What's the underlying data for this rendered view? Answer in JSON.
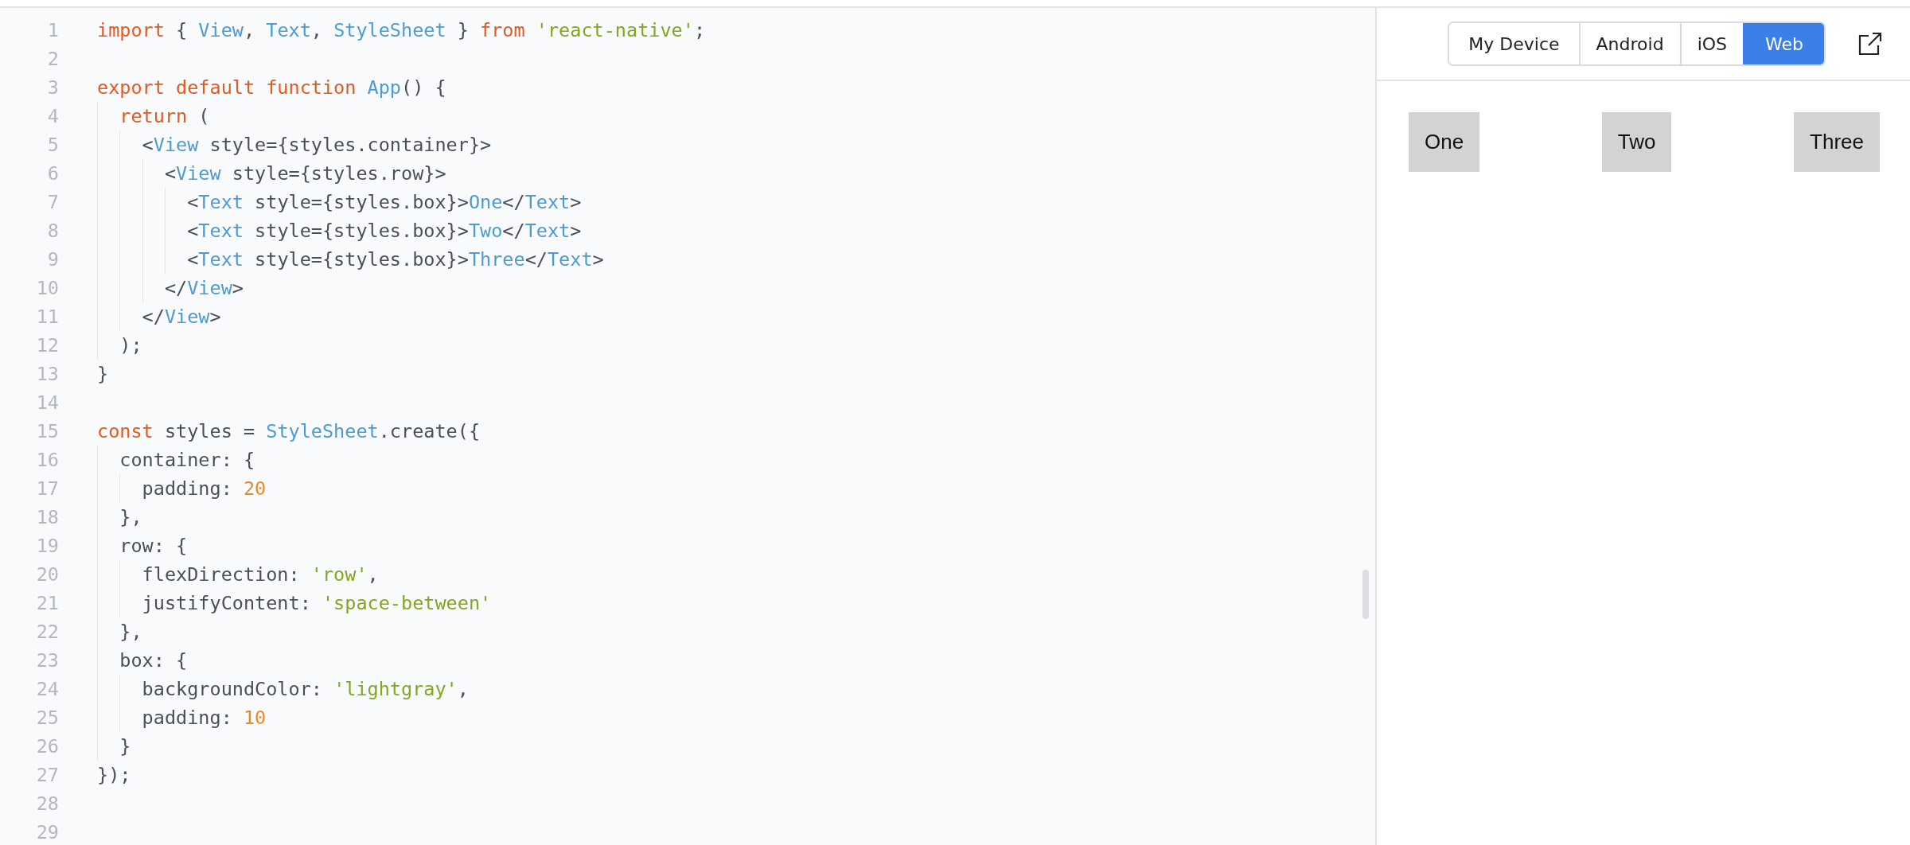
{
  "editor": {
    "lines": [
      {
        "number": "1",
        "tokens": [
          {
            "kind": "keyword",
            "text": "import"
          },
          {
            "kind": "plain",
            "text": " { "
          },
          {
            "kind": "identifier",
            "text": "View"
          },
          {
            "kind": "plain",
            "text": ", "
          },
          {
            "kind": "identifier",
            "text": "Text"
          },
          {
            "kind": "plain",
            "text": ", "
          },
          {
            "kind": "identifier",
            "text": "StyleSheet"
          },
          {
            "kind": "plain",
            "text": " } "
          },
          {
            "kind": "keyword",
            "text": "from "
          },
          {
            "kind": "string",
            "text": "'react-native'"
          },
          {
            "kind": "plain",
            "text": ";"
          }
        ]
      },
      {
        "number": "2"
      },
      {
        "number": "3",
        "tokens": [
          {
            "kind": "keyword",
            "text": "export default function "
          },
          {
            "kind": "identifier",
            "text": "App"
          },
          {
            "kind": "plain",
            "text": "() {"
          }
        ]
      },
      {
        "number": "4",
        "tokens": [
          {
            "kind": "keyword",
            "text": "  return"
          },
          {
            "kind": "plain",
            "text": " ("
          }
        ]
      },
      {
        "number": "5",
        "tokens": [
          {
            "kind": "plain",
            "text": "    <"
          },
          {
            "kind": "identifier",
            "text": "View"
          },
          {
            "kind": "plain",
            "text": " style={styles.container}>"
          }
        ]
      },
      {
        "number": "6",
        "tokens": [
          {
            "kind": "plain",
            "text": "      <"
          },
          {
            "kind": "identifier",
            "text": "View"
          },
          {
            "kind": "plain",
            "text": " style={styles.row}>"
          }
        ]
      },
      {
        "number": "7",
        "tokens": [
          {
            "kind": "plain",
            "text": "        <"
          },
          {
            "kind": "identifier",
            "text": "Text"
          },
          {
            "kind": "plain",
            "text": " style={styles.box}>"
          },
          {
            "kind": "identifier",
            "text": "One"
          },
          {
            "kind": "plain",
            "text": "</"
          },
          {
            "kind": "identifier",
            "text": "Text"
          },
          {
            "kind": "plain",
            "text": ">"
          }
        ]
      },
      {
        "number": "8",
        "tokens": [
          {
            "kind": "plain",
            "text": "        <"
          },
          {
            "kind": "identifier",
            "text": "Text"
          },
          {
            "kind": "plain",
            "text": " style={styles.box}>"
          },
          {
            "kind": "identifier",
            "text": "Two"
          },
          {
            "kind": "plain",
            "text": "</"
          },
          {
            "kind": "identifier",
            "text": "Text"
          },
          {
            "kind": "plain",
            "text": ">"
          }
        ]
      },
      {
        "number": "9",
        "tokens": [
          {
            "kind": "plain",
            "text": "        <"
          },
          {
            "kind": "identifier",
            "text": "Text"
          },
          {
            "kind": "plain",
            "text": " style={styles.box}>"
          },
          {
            "kind": "identifier",
            "text": "Three"
          },
          {
            "kind": "plain",
            "text": "</"
          },
          {
            "kind": "identifier",
            "text": "Text"
          },
          {
            "kind": "plain",
            "text": ">"
          }
        ]
      },
      {
        "number": "10",
        "tokens": [
          {
            "kind": "plain",
            "text": "      </"
          },
          {
            "kind": "identifier",
            "text": "View"
          },
          {
            "kind": "plain",
            "text": ">"
          }
        ]
      },
      {
        "number": "11",
        "tokens": [
          {
            "kind": "plain",
            "text": "    </"
          },
          {
            "kind": "identifier",
            "text": "View"
          },
          {
            "kind": "plain",
            "text": ">"
          }
        ]
      },
      {
        "number": "12",
        "tokens": [
          {
            "kind": "plain",
            "text": "  );"
          }
        ]
      },
      {
        "number": "13",
        "tokens": [
          {
            "kind": "plain",
            "text": "}"
          }
        ]
      },
      {
        "number": "14"
      },
      {
        "number": "15",
        "tokens": [
          {
            "kind": "keyword",
            "text": "const"
          },
          {
            "kind": "plain",
            "text": " styles = "
          },
          {
            "kind": "identifier",
            "text": "StyleSheet"
          },
          {
            "kind": "plain",
            "text": ".create({"
          }
        ]
      },
      {
        "number": "16",
        "tokens": [
          {
            "kind": "plain",
            "text": "  container: {"
          }
        ]
      },
      {
        "number": "17",
        "tokens": [
          {
            "kind": "plain",
            "text": "    padding: "
          },
          {
            "kind": "number",
            "text": "20"
          }
        ]
      },
      {
        "number": "18",
        "tokens": [
          {
            "kind": "plain",
            "text": "  },"
          }
        ]
      },
      {
        "number": "19",
        "tokens": [
          {
            "kind": "plain",
            "text": "  row: {"
          }
        ]
      },
      {
        "number": "20",
        "tokens": [
          {
            "kind": "plain",
            "text": "    flexDirection: "
          },
          {
            "kind": "string",
            "text": "'row'"
          },
          {
            "kind": "plain",
            "text": ","
          }
        ]
      },
      {
        "number": "21",
        "tokens": [
          {
            "kind": "plain",
            "text": "    justifyContent: "
          },
          {
            "kind": "string",
            "text": "'space-between'"
          }
        ]
      },
      {
        "number": "22",
        "tokens": [
          {
            "kind": "plain",
            "text": "  },"
          }
        ]
      },
      {
        "number": "23",
        "tokens": [
          {
            "kind": "plain",
            "text": "  box: {"
          }
        ]
      },
      {
        "number": "24",
        "tokens": [
          {
            "kind": "plain",
            "text": "    backgroundColor: "
          },
          {
            "kind": "string",
            "text": "'lightgray'"
          },
          {
            "kind": "plain",
            "text": ","
          }
        ]
      },
      {
        "number": "25",
        "tokens": [
          {
            "kind": "plain",
            "text": "    padding: "
          },
          {
            "kind": "number",
            "text": "10"
          }
        ]
      },
      {
        "number": "26",
        "tokens": [
          {
            "kind": "plain",
            "text": "  }"
          }
        ]
      },
      {
        "number": "27",
        "tokens": [
          {
            "kind": "plain",
            "text": "});"
          }
        ]
      },
      {
        "number": "28"
      },
      {
        "number": "29"
      }
    ]
  },
  "preview": {
    "platforms": [
      {
        "label": "My Device",
        "selected": false
      },
      {
        "label": "Android",
        "selected": false
      },
      {
        "label": "iOS",
        "selected": false
      },
      {
        "label": "Web",
        "selected": true
      }
    ],
    "boxes": [
      "One",
      "Two",
      "Three"
    ]
  }
}
